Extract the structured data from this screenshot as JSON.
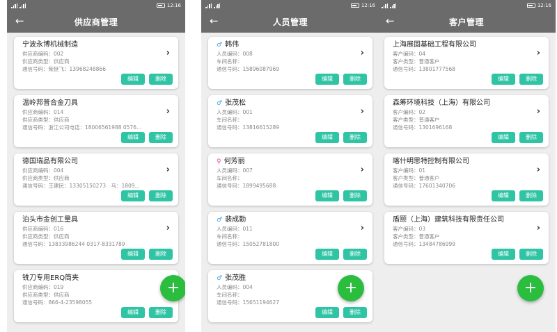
{
  "status": {
    "time": "12:16"
  },
  "icons": {
    "back": "arrow-left-icon",
    "chevron": "chevron-right-icon",
    "add": "plus-icon",
    "male": "male-icon",
    "female": "female-icon"
  },
  "colors": {
    "appbar": "#6b6b6b",
    "action_button": "#2ec4a4",
    "fab": "#2bbd3e"
  },
  "actions": {
    "edit": "编辑",
    "delete": "删除",
    "back_glyph": "←",
    "chevron_glyph": "›",
    "add_glyph": "+"
  },
  "suppliers": {
    "title": "供应商管理",
    "items": [
      {
        "name": "宁波永博机械制造",
        "code": "供应商编码：002",
        "type": "供应商类型：供应商",
        "phone": "通信号码：柴挺飞：13968248866"
      },
      {
        "name": "温岭邦普合金刀具",
        "code": "供应商编码：014",
        "type": "供应商类型：供应商",
        "phone": "通信号码：浙江公司电话：18006561988 0576..."
      },
      {
        "name": "德国瑞品有限公司",
        "code": "供应商编码：004",
        "type": "供应商类型：供应商",
        "phone": "通信号码：王建民：13305150273　马：1809..."
      },
      {
        "name": "泊头市金创工量具",
        "code": "供应商编码：016",
        "type": "供应商类型：供应商",
        "phone": "通信号码：13833986244 0317-8331789"
      },
      {
        "name": "铣刀专用ERQ筒夹",
        "code": "供应商编码：019",
        "type": "供应商类型：供应商",
        "phone": "通信号码：866-4-23598055"
      }
    ]
  },
  "personnel": {
    "title": "人员管理",
    "items": [
      {
        "gender": "male",
        "gender_glyph": "♂",
        "name": "韩伟",
        "code": "人员编码：008",
        "workshop": "车间名称：",
        "phone": "通信号码：15896087969"
      },
      {
        "gender": "male",
        "gender_glyph": "♂",
        "name": "张茂松",
        "code": "人员编码：001",
        "workshop": "车间名称：",
        "phone": "通信号码：13816615289"
      },
      {
        "gender": "female",
        "gender_glyph": "♀",
        "name": "何芳丽",
        "code": "人员编码：007",
        "workshop": "车间名称：",
        "phone": "通信号码：1899495688"
      },
      {
        "gender": "male",
        "gender_glyph": "♂",
        "name": "裴成勤",
        "code": "人员编码：011",
        "workshop": "车间名称：",
        "phone": "通信号码：15052781800"
      },
      {
        "gender": "male",
        "gender_glyph": "♂",
        "name": "张茂胜",
        "code": "人员编码：004",
        "workshop": "车间名称：",
        "phone": "通信号码：15651194627"
      }
    ]
  },
  "customers": {
    "title": "客户管理",
    "items": [
      {
        "name": "上海展固基础工程有限公司",
        "code": "客户编码：04",
        "type": "客户类型：普通客户",
        "phone": "通信号码：13801777568"
      },
      {
        "name": "森筹环境科技（上海）有限公司",
        "code": "客户编码：02",
        "type": "客户类型：普通客户",
        "phone": "通信号码：1301696168"
      },
      {
        "name": "喀什明思特控制有限公司",
        "code": "客户编码：01",
        "type": "客户类型：普通客户",
        "phone": "通信号码：17601340706"
      },
      {
        "name": "盾颐（上海）建筑科技有限责任公司",
        "code": "客户编码：03",
        "type": "客户类型：普通客户",
        "phone": "通信号码：13484786999"
      }
    ]
  }
}
